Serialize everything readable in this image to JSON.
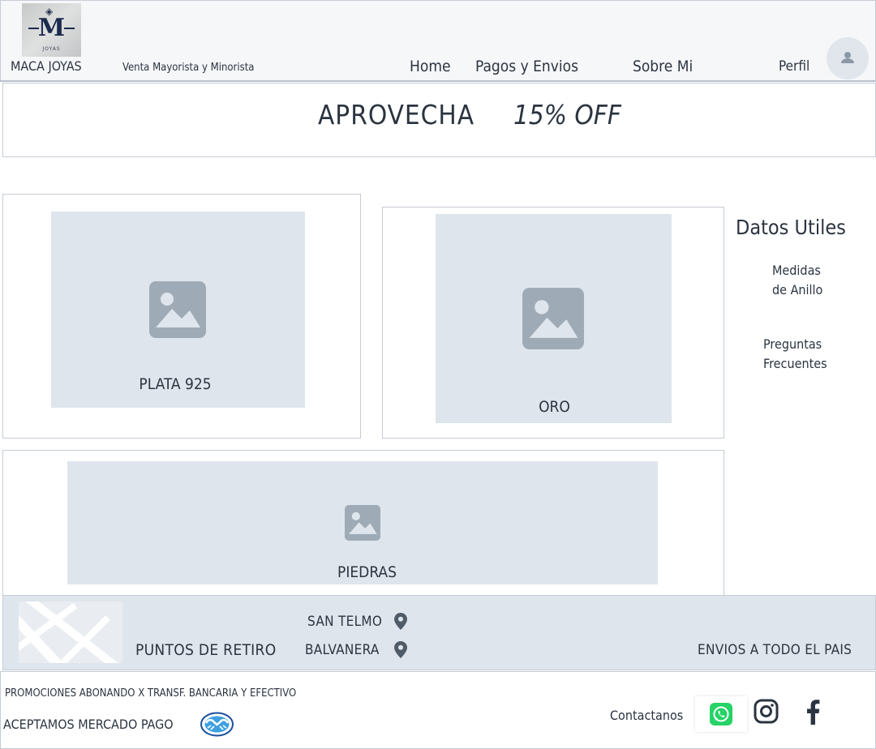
{
  "header": {
    "logo": {
      "letter": "M",
      "subtext": "JOYAS"
    },
    "brand": "MACA JOYAS",
    "tagline": "Venta Mayorista y Minorista",
    "nav": [
      {
        "label": "Home"
      },
      {
        "label": "Pagos y Envios"
      },
      {
        "label": "Sobre Mi"
      }
    ],
    "profile_label": "Perfil"
  },
  "promo": {
    "headline": "APROVECHA",
    "offer": "15% OFF"
  },
  "categories": [
    {
      "label": "PLATA 925"
    },
    {
      "label": "ORO"
    },
    {
      "label": "PIEDRAS"
    }
  ],
  "sidebar": {
    "title": "Datos Utiles",
    "links": [
      {
        "line1": "Medidas",
        "line2": "de Anillo"
      },
      {
        "line1": "Preguntas",
        "line2": "Frecuentes"
      }
    ]
  },
  "pickup": {
    "title": "PUNTOS DE RETIRO",
    "locations": [
      "SAN TELMO",
      "BALVANERA"
    ],
    "shipping": "ENVIOS A TODO EL PAIS"
  },
  "footer": {
    "promotions": "PROMOCIONES ABONANDO X TRANSF. BANCARIA Y EFECTIVO",
    "payment": "ACEPTAMOS MERCADO PAGO",
    "contact_label": "Contactanos",
    "social": [
      "whatsapp-icon",
      "instagram-icon",
      "facebook-icon"
    ]
  },
  "colors": {
    "placeholder": "#dfe5ec",
    "placeholder_icon": "#9eabb7",
    "text": "#2b3440",
    "whatsapp": "#25d366"
  }
}
